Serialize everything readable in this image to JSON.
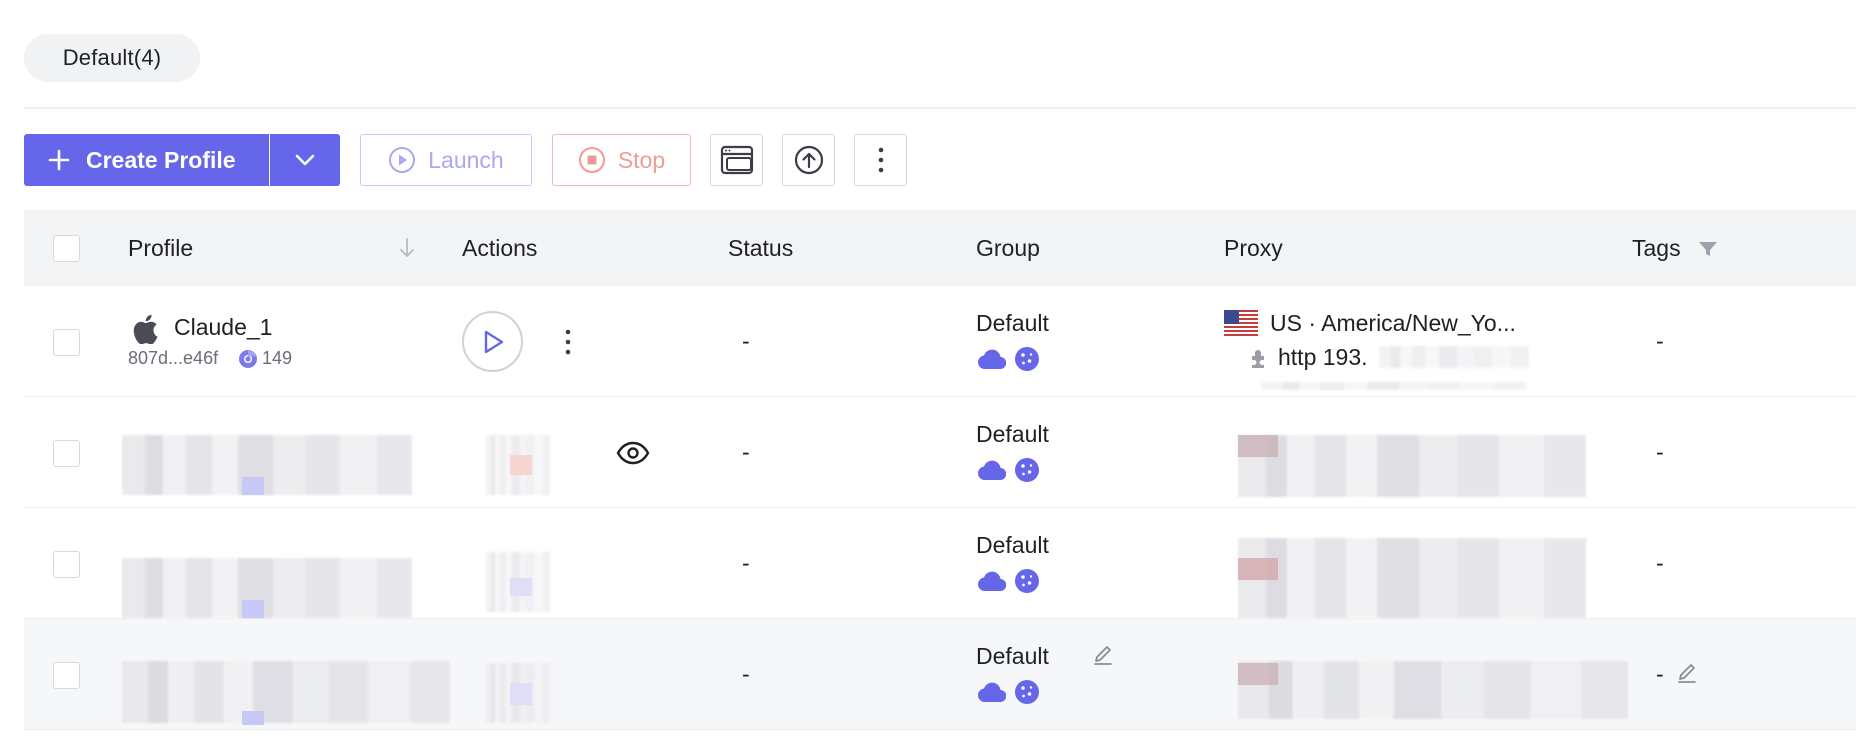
{
  "groups": {
    "active_tab": "Default(4)"
  },
  "toolbar": {
    "create_label": "Create Profile",
    "launch_label": "Launch",
    "stop_label": "Stop"
  },
  "table": {
    "columns": [
      "Profile",
      "Actions",
      "Status",
      "Group",
      "Proxy",
      "Tags"
    ],
    "rows": [
      {
        "profile_name": "Claude_1",
        "profile_id": "807d...e46f",
        "browser_version": "149",
        "status": "-",
        "group": "Default",
        "proxy_location": "US · America/New_Yo...",
        "proxy_address": "http 193.",
        "tags": "-"
      },
      {
        "status": "-",
        "group": "Default",
        "tags": "-"
      },
      {
        "status": "-",
        "group": "Default",
        "tags": "-"
      },
      {
        "status": "-",
        "group": "Default",
        "tags": "-"
      }
    ]
  },
  "colors": {
    "primary": "#6566e9",
    "launch_disabled": "#a9a9ec",
    "stop_disabled": "#ee9d95",
    "header_bg": "#f3f4f6"
  },
  "icons": {
    "os": "apple-icon",
    "browser": "chromium-icon",
    "flag": "us-flag-icon",
    "proxy": "plugin-icon",
    "sync": "cloud-icon",
    "cookies": "cookie-icon"
  }
}
